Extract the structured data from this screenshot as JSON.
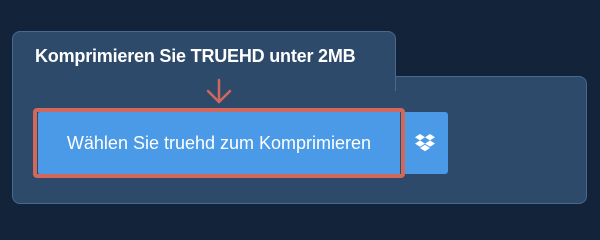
{
  "card": {
    "title": "Komprimieren Sie TRUEHD unter 2MB"
  },
  "upload": {
    "button_label": "Wählen Sie truehd zum Komprimieren",
    "dropbox_icon": "dropbox-icon"
  },
  "colors": {
    "page_background": "#13243a",
    "card_background": "#2d4a6b",
    "button": "#4a9ae8",
    "highlight": "#d2675c"
  }
}
